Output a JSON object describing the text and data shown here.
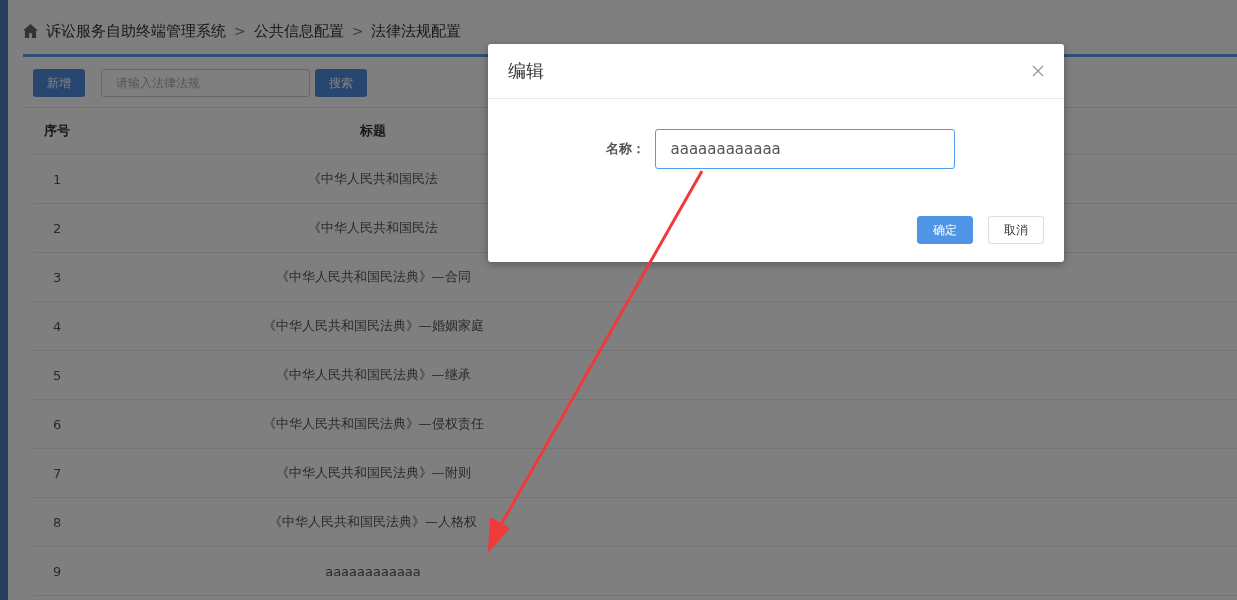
{
  "breadcrumb": {
    "items": [
      "诉讼服务自助终端管理系统",
      "公共信息配置",
      "法律法规配置"
    ],
    "separators": [
      ">",
      ">"
    ]
  },
  "toolbar": {
    "add_button": "新增",
    "search": {
      "placeholder": "请输入法律法规"
    },
    "search_button": "搜索"
  },
  "table": {
    "columns": [
      "序号",
      "标题"
    ],
    "rows": [
      {
        "index": "1",
        "title": "《中华人民共和国民法"
      },
      {
        "index": "2",
        "title": "《中华人民共和国民法"
      },
      {
        "index": "3",
        "title": "《中华人民共和国民法典》—合同"
      },
      {
        "index": "4",
        "title": "《中华人民共和国民法典》—婚姻家庭"
      },
      {
        "index": "5",
        "title": "《中华人民共和国民法典》—继承"
      },
      {
        "index": "6",
        "title": "《中华人民共和国民法典》—侵权责任"
      },
      {
        "index": "7",
        "title": "《中华人民共和国民法典》—附则"
      },
      {
        "index": "8",
        "title": "《中华人民共和国民法典》—人格权"
      },
      {
        "index": "9",
        "title": "aaaaaaaaaaaa"
      }
    ]
  },
  "dialog": {
    "title": "编辑",
    "field": {
      "label": "名称：",
      "value": "aaaaaaaaaaaa"
    },
    "buttons": [
      {
        "label": "确定",
        "kind": "primary"
      },
      {
        "label": "取消",
        "kind": "default"
      }
    ]
  }
}
